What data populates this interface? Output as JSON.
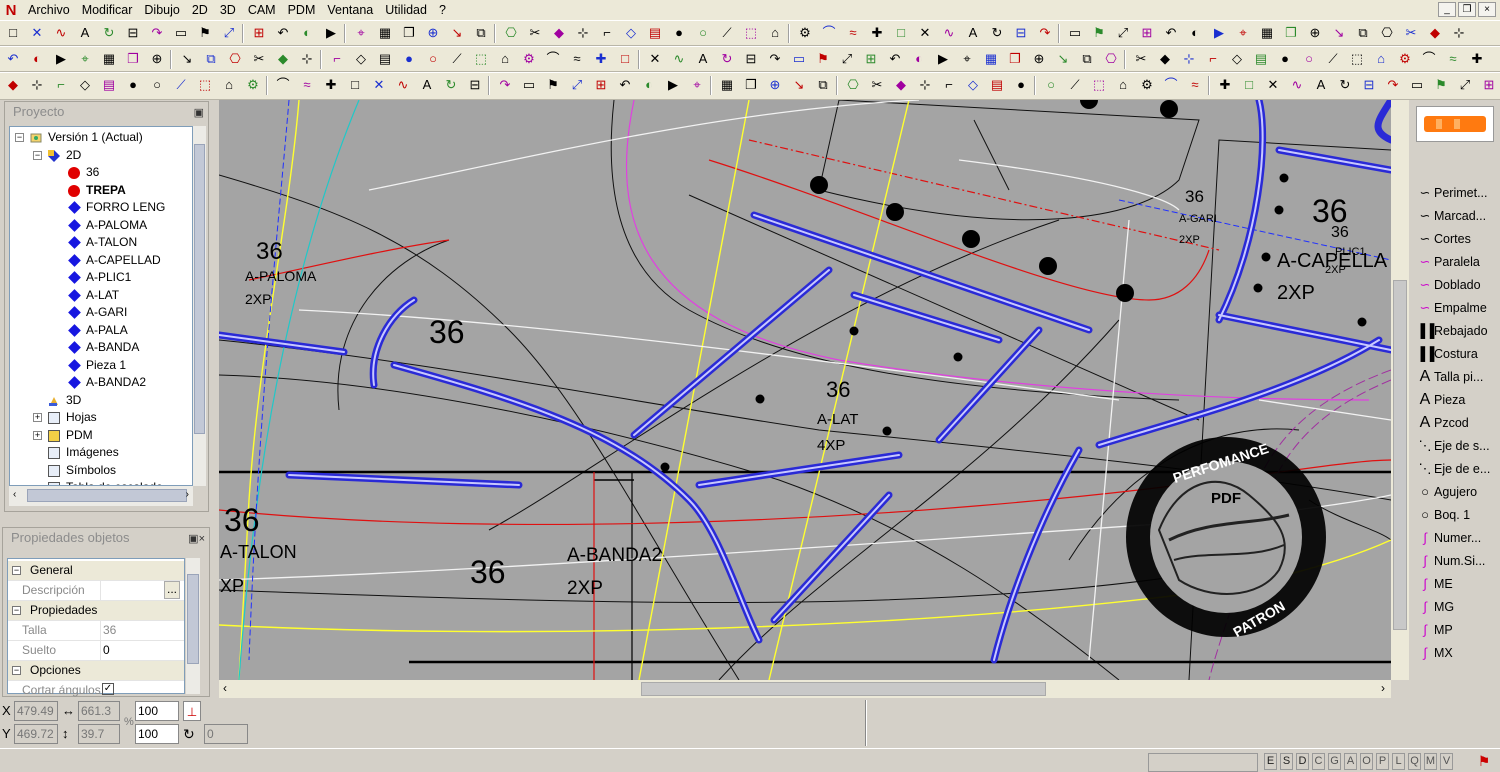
{
  "app": {
    "logo": "N"
  },
  "menu": [
    "Archivo",
    "Modificar",
    "Dibujo",
    "2D",
    "3D",
    "CAM",
    "PDM",
    "Ventana",
    "Utilidad",
    "?"
  ],
  "window_controls": [
    "_",
    "❐",
    "×"
  ],
  "project_panel": {
    "title": "Proyecto",
    "tree": {
      "root": "Versión 1 (Actual)",
      "node_2d": "2D",
      "pieces": [
        "36",
        "TREPA",
        "FORRO LENG",
        "A-PALOMA",
        "A-TALON",
        "A-CAPELLAD",
        "A-PLIC1",
        "A-LAT",
        "A-GARI",
        "A-PALA",
        "A-BANDA",
        "Pieza 1",
        "A-BANDA2"
      ],
      "node_3d": "3D",
      "others": [
        "Hojas",
        "PDM",
        "Imágenes",
        "Símbolos",
        "Tabla de escalado"
      ]
    }
  },
  "properties_panel": {
    "title": "Propiedades objetos",
    "cat_general": "General",
    "desc_key": "Descripción",
    "desc_btn": "...",
    "cat_props": "Propiedades",
    "talla_key": "Talla",
    "talla_val": "36",
    "suelto_key": "Suelto",
    "suelto_val": "0",
    "cat_options": "Opciones",
    "cortar_key": "Cortar ángulos"
  },
  "canvas": {
    "labels": [
      {
        "t": "36",
        "size": "24"
      },
      {
        "t": "A-PALOMA",
        "size": "14"
      },
      {
        "t": "2XP",
        "size": "14"
      },
      {
        "t": "36",
        "size": "32"
      },
      {
        "t": "36",
        "size": "22"
      },
      {
        "t": "A-LAT",
        "size": "15"
      },
      {
        "t": "4XP",
        "size": "15"
      },
      {
        "t": "36",
        "size": "32"
      },
      {
        "t": "A-TALON",
        "size": "18"
      },
      {
        "t": "XP",
        "size": "18"
      },
      {
        "t": "36",
        "size": "32"
      },
      {
        "t": "A-BANDA2",
        "size": "19"
      },
      {
        "t": "2XP",
        "size": "19"
      },
      {
        "t": "36",
        "size": "17"
      },
      {
        "t": "A-GARI",
        "size": "11"
      },
      {
        "t": "2XP",
        "size": "11"
      },
      {
        "t": "36",
        "size": "32"
      },
      {
        "t": "36",
        "size": "16"
      },
      {
        "t": "A-CAPELLA",
        "size": "20"
      },
      {
        "t": "2XP",
        "size": "20"
      },
      {
        "t": "PLIC1",
        "size": "11"
      },
      {
        "t": "2XP",
        "size": "11"
      }
    ],
    "watermark": {
      "top": "PERFOMANCE",
      "center": "PDF",
      "bottom": "PATRON"
    }
  },
  "right_panel": {
    "tools": [
      {
        "label": "Perimet...",
        "icon": "curve-icon",
        "color": "#000000"
      },
      {
        "label": "Marcad...",
        "icon": "curve-icon",
        "color": "#000000"
      },
      {
        "label": "Cortes",
        "icon": "curve-icon",
        "color": "#000000"
      },
      {
        "label": "Paralela",
        "icon": "curve-icon",
        "color": "#cc00cc"
      },
      {
        "label": "Doblado",
        "icon": "curve-icon",
        "color": "#cc00cc"
      },
      {
        "label": "Empalme",
        "icon": "curve-icon",
        "color": "#cc00cc"
      },
      {
        "label": "Rebajado",
        "icon": "seam-icon",
        "color": "#000000"
      },
      {
        "label": "Costura",
        "icon": "seam-icon",
        "color": "#000000"
      },
      {
        "label": "Talla pi...",
        "icon": "text-icon",
        "color": "#000000"
      },
      {
        "label": "Pieza",
        "icon": "text-icon",
        "color": "#000000"
      },
      {
        "label": "Pzcod",
        "icon": "text-icon",
        "color": "#000000"
      },
      {
        "label": "Eje de s...",
        "icon": "axis-icon",
        "color": "#000000"
      },
      {
        "label": "Eje de e...",
        "icon": "axis-icon",
        "color": "#000000"
      },
      {
        "label": "Agujero",
        "icon": "circle-icon",
        "color": "#000000"
      },
      {
        "label": "Boq. 1",
        "icon": "circle-icon",
        "color": "#000000"
      },
      {
        "label": "Numer...",
        "icon": "pen-icon",
        "color": "#cc00cc"
      },
      {
        "label": "Num.Si...",
        "icon": "pen-icon",
        "color": "#cc00cc"
      },
      {
        "label": "ME",
        "icon": "pen-icon",
        "color": "#cc00cc"
      },
      {
        "label": "MG",
        "icon": "pen-icon",
        "color": "#cc00cc"
      },
      {
        "label": "MP",
        "icon": "pen-icon",
        "color": "#cc00cc"
      },
      {
        "label": "MX",
        "icon": "pen-icon",
        "color": "#cc00cc"
      }
    ]
  },
  "status": {
    "x_label": "X",
    "x_val": "479.49",
    "w_val": "661.3",
    "y_label": "Y",
    "y_val": "469.72",
    "h_val": "39.7",
    "pct_label": "%",
    "pct1": "100",
    "pct2": "100",
    "rot": "0"
  },
  "flags": [
    "E",
    "S",
    "D",
    "C",
    "G",
    "A",
    "O",
    "P",
    "L",
    "Q",
    "M",
    "V"
  ]
}
